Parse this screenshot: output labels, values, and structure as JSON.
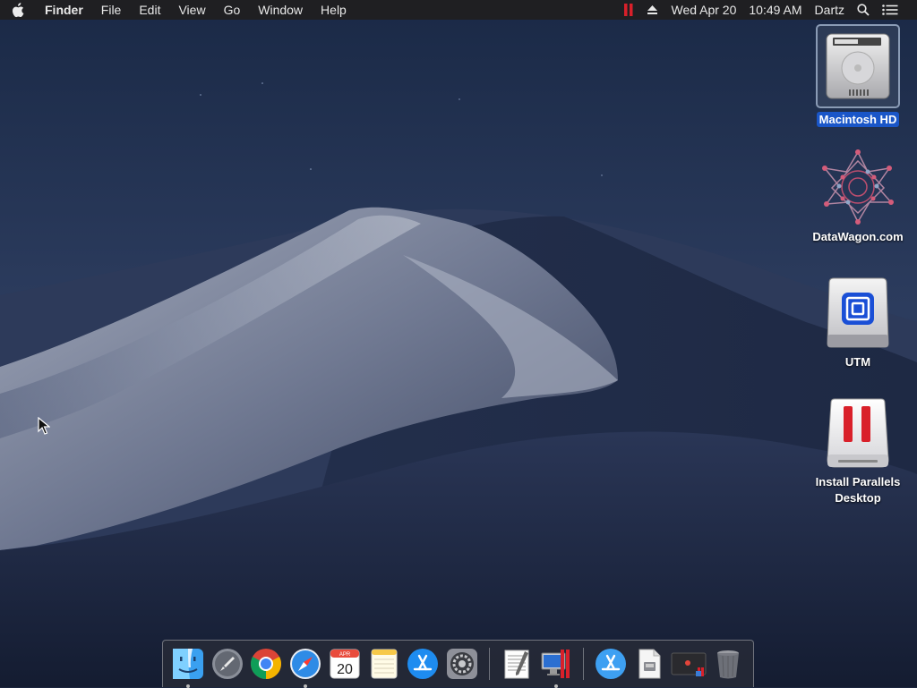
{
  "menubar": {
    "app_name": "Finder",
    "menus": [
      "File",
      "Edit",
      "View",
      "Go",
      "Window",
      "Help"
    ],
    "status": {
      "parallels_icon": "parallels-icon",
      "eject_icon": "eject-icon",
      "date": "Wed Apr 20",
      "time": "10:49 AM",
      "user": "Dartz",
      "search_icon": "search-icon",
      "notification_icon": "list-icon"
    }
  },
  "desktop": {
    "icons": [
      {
        "label": "Macintosh HD",
        "icon": "hard-drive-icon",
        "selected": true
      },
      {
        "label": "DataWagon.com",
        "icon": "datawagon-icon",
        "selected": false
      },
      {
        "label": "UTM",
        "icon": "utm-drive-icon",
        "selected": false
      },
      {
        "label": "Install Parallels\nDesktop",
        "label_line1": "Install Parallels",
        "label_line2": "Desktop",
        "icon": "parallels-installer-icon",
        "selected": false
      }
    ]
  },
  "dock": {
    "apps": [
      {
        "name": "Finder",
        "icon": "finder-icon",
        "running": true
      },
      {
        "name": "Launchpad",
        "icon": "launchpad-icon",
        "running": false
      },
      {
        "name": "Google Chrome",
        "icon": "chrome-icon",
        "running": false
      },
      {
        "name": "Safari",
        "icon": "safari-icon",
        "running": true
      },
      {
        "name": "Calendar",
        "icon": "calendar-icon",
        "running": false,
        "month": "APR",
        "day": "20"
      },
      {
        "name": "Notes",
        "icon": "notes-icon",
        "running": false
      },
      {
        "name": "App Store",
        "icon": "app-store-icon",
        "running": false
      },
      {
        "name": "System Preferences",
        "icon": "system-preferences-icon",
        "running": false
      },
      {
        "name": "TextEdit",
        "icon": "textedit-icon",
        "running": false
      },
      {
        "name": "Parallels Desktop",
        "icon": "parallels-desktop-icon",
        "running": true
      },
      {
        "name": "Applications",
        "icon": "applications-folder-icon",
        "running": false
      },
      {
        "name": "Document",
        "icon": "document-icon",
        "running": false
      },
      {
        "name": "Screen Recording",
        "icon": "screen-recording-icon",
        "running": false
      },
      {
        "name": "Trash",
        "icon": "trash-icon",
        "running": false
      }
    ]
  },
  "colors": {
    "menubar_bg": "#1f1f22",
    "selection": "#1a56c8",
    "parallels_red": "#d9202a",
    "sky_top": "#1b2a46",
    "dune_light": "#8e97ab"
  }
}
